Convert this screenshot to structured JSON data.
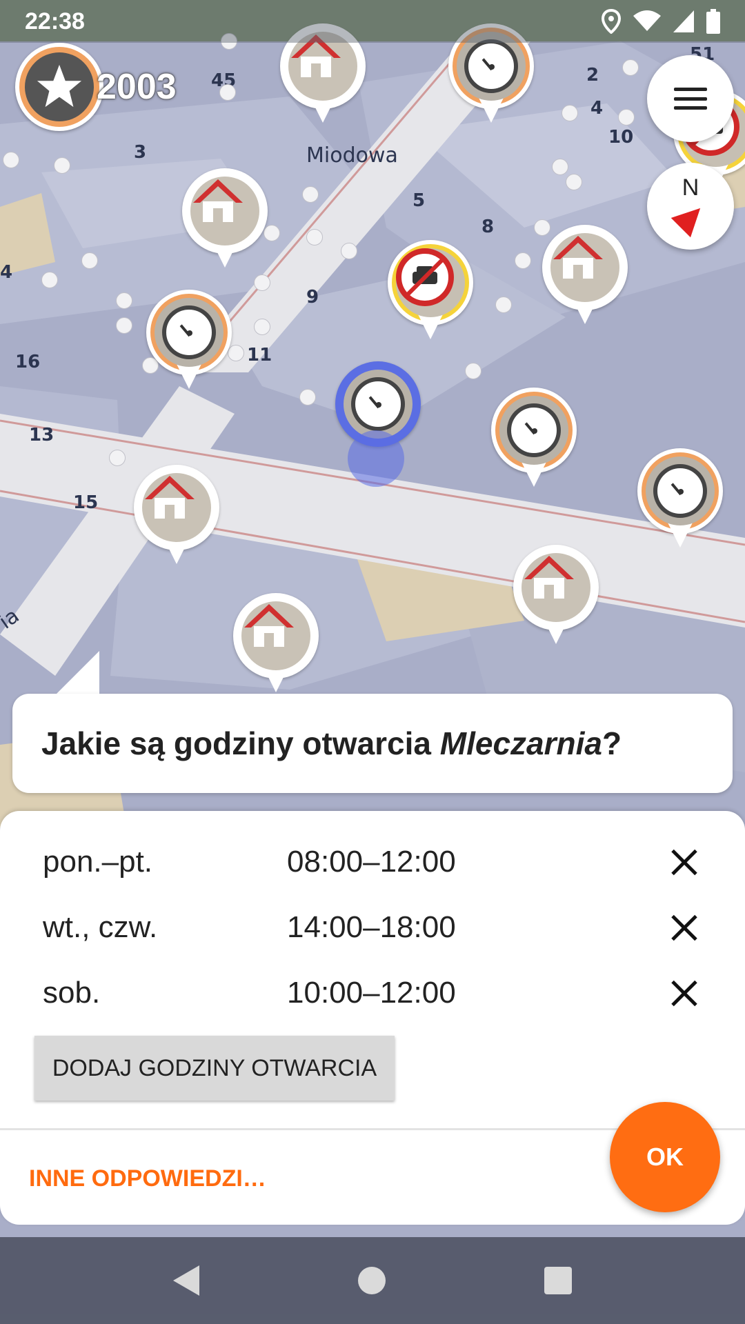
{
  "status_bar": {
    "time": "22:38"
  },
  "score": "2003",
  "map": {
    "street_label": "Miodowa",
    "street_label_2": "ia",
    "house_numbers": [
      "45",
      "2",
      "4",
      "10",
      "3",
      "5",
      "8",
      "9",
      "4",
      "16",
      "11",
      "13",
      "15",
      "51"
    ]
  },
  "compass": {
    "label": "N"
  },
  "question": {
    "prefix": "Jakie są godziny otwarcia ",
    "place": "Mleczarnia",
    "suffix": "?"
  },
  "hours": [
    {
      "days": "pon.–pt.",
      "time": "08:00–12:00"
    },
    {
      "days": "wt., czw.",
      "time": "14:00–18:00"
    },
    {
      "days": "sob.",
      "time": "10:00–12:00"
    }
  ],
  "buttons": {
    "add_hours": "DODAJ GODZINY OTWARCIA",
    "other_answers": "INNE ODPOWIEDZI…",
    "ok": "OK"
  },
  "colors": {
    "accent": "#ff6d12",
    "clock_ring": "#f0a160",
    "active_ring": "#5b6ee3",
    "no_parking_ring": "#f5d33a",
    "nav_bar": "#464b5a"
  },
  "icons": [
    "location-icon",
    "wifi-icon",
    "signal-icon",
    "battery-icon",
    "star-icon",
    "menu-icon",
    "compass-arrow-icon",
    "clock-icon",
    "home-icon",
    "no-parking-icon",
    "close-icon",
    "back-icon",
    "home-nav-icon",
    "recents-icon"
  ]
}
